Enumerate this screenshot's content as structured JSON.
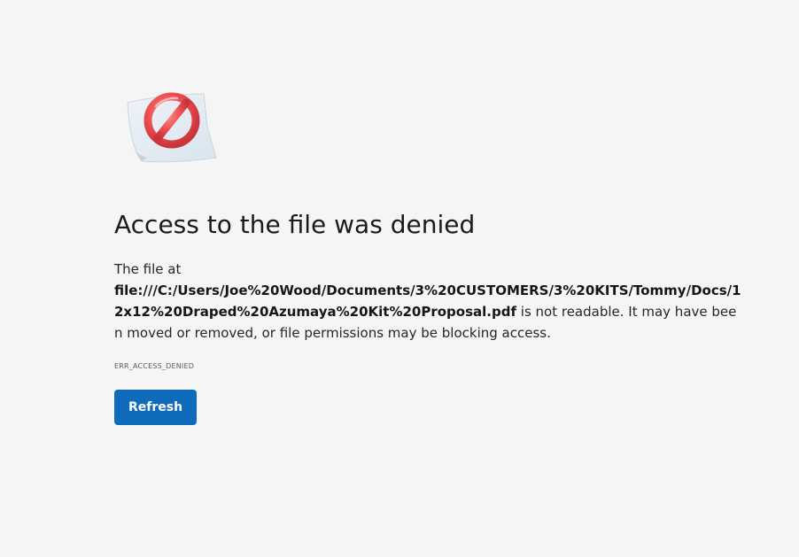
{
  "icon": "blocked-file-icon",
  "colors": {
    "background": "#f5f5f5",
    "accent": "#0f6cbd",
    "block_red": "#e8474a"
  },
  "error": {
    "title": "Access to the file was denied",
    "body_prefix": "The file at",
    "file_path": "file:///C:/Users/Joe%20Wood/Documents/3%20CUSTOMERS/3%20KITS/Tommy/Docs/12x12%20Draped%20Azumaya%20Kit%20Proposal.pdf",
    "body_suffix": "is not readable. It may have been moved or removed, or file permissions may be blocking access.",
    "code": "ERR_ACCESS_DENIED",
    "refresh_label": "Refresh"
  }
}
